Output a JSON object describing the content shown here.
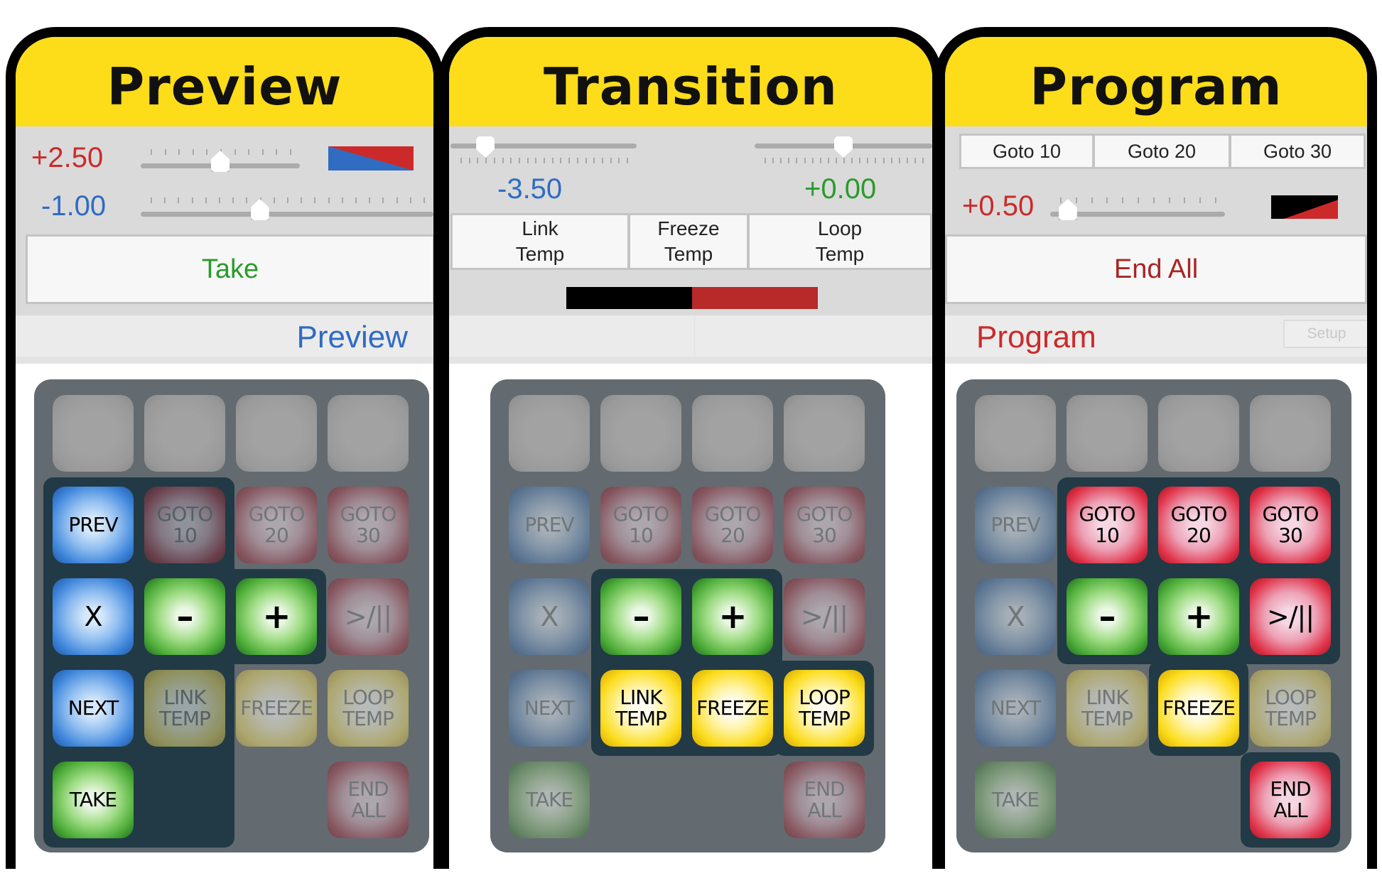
{
  "colors": {
    "header_yellow": "#fddc1a",
    "red": "#cc2a2a",
    "blue": "#2f6cc2",
    "green": "#2b9a2b",
    "dark_red": "#a82424"
  },
  "panels": {
    "preview": {
      "title": "Preview",
      "slider1": {
        "value_text": "+2.50",
        "position": 0.5
      },
      "slider2": {
        "value_text": "-1.00",
        "position": 0.4
      },
      "swatch": {
        "colors": [
          "#2f6cc2",
          "#cc2a2a"
        ]
      },
      "take_button": "Take",
      "mode_label": "Preview"
    },
    "transition": {
      "title": "Transition",
      "slider_left": {
        "value_text": "-3.50",
        "position": 0.15
      },
      "slider_right": {
        "value_text": "+0.00",
        "position": 0.5
      },
      "buttons": [
        {
          "line1": "Link",
          "line2": "Temp"
        },
        {
          "line1": "Freeze",
          "line2": "Temp"
        },
        {
          "line1": "Loop",
          "line2": "Temp"
        }
      ],
      "mix_bar": {
        "colors": [
          "#000000",
          "#b8292a"
        ],
        "split": 0.5
      }
    },
    "program": {
      "title": "Program",
      "goto_buttons": [
        "Goto 10",
        "Goto 20",
        "Goto 30"
      ],
      "slider": {
        "value_text": "+0.50",
        "position": 0.05
      },
      "swatch": {
        "colors": [
          "#000000",
          "#cc2a2a"
        ]
      },
      "end_all_button": "End All",
      "mode_label": "Program",
      "setup_button": "Setup"
    }
  },
  "keypad_labels": {
    "prev": "PREV",
    "x": "X",
    "next": "NEXT",
    "take": "TAKE",
    "goto10_l1": "GOTO",
    "goto10_l2": "10",
    "goto20_l1": "GOTO",
    "goto20_l2": "20",
    "goto30_l1": "GOTO",
    "goto30_l2": "30",
    "minus": "–",
    "plus": "+",
    "playpause": ">/||",
    "link_l1": "LINK",
    "link_l2": "TEMP",
    "freeze": "FREEZE",
    "loop_l1": "LOOP",
    "loop_l2": "TEMP",
    "end_l1": "END",
    "end_l2": "ALL"
  },
  "keypads": {
    "preview": {
      "active": [
        "prev",
        "x",
        "next",
        "take",
        "minus",
        "plus"
      ]
    },
    "transition": {
      "active": [
        "minus",
        "plus",
        "link",
        "freeze",
        "loop"
      ]
    },
    "program": {
      "active": [
        "goto10",
        "goto20",
        "goto30",
        "minus",
        "plus",
        "playpause",
        "freeze",
        "endall"
      ]
    }
  }
}
